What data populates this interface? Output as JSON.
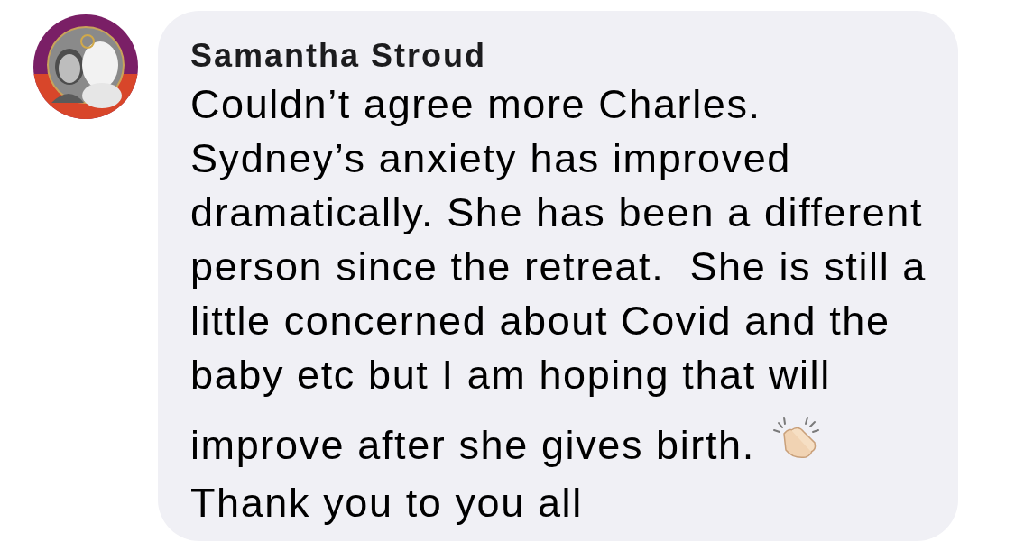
{
  "comment": {
    "author": "Samantha Stroud",
    "lines": [
      {
        "kind": "text",
        "text": "Couldn’t agree more Charles."
      },
      {
        "kind": "text",
        "text": "Sydney’s anxiety has improved"
      },
      {
        "kind": "text",
        "text": "dramatically. She has been a different"
      },
      {
        "kind": "text",
        "text": "person since the retreat.  She is still a"
      },
      {
        "kind": "text",
        "text": "little concerned about Covid and the"
      },
      {
        "kind": "text",
        "text": "baby etc but I am hoping that will"
      },
      {
        "kind": "clap",
        "text": "improve after she gives birth."
      },
      {
        "kind": "text",
        "text": "Thank you to you all"
      }
    ]
  }
}
